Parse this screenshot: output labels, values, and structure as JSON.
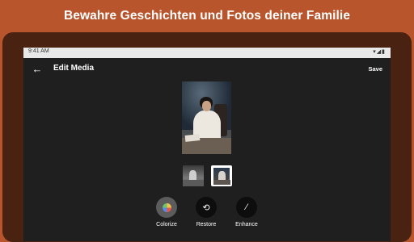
{
  "headline": "Bewahre Geschichten und Fotos deiner Familie",
  "status_bar": {
    "time": "9:41 AM",
    "icons": [
      "wifi-icon",
      "signal-icon",
      "battery-icon"
    ]
  },
  "app_bar": {
    "back_icon": "arrow-left-icon",
    "title": "Edit Media",
    "save_label": "Save"
  },
  "preview": {
    "description_icon": "photo"
  },
  "thumbnails": [
    {
      "variant": "original-bw",
      "selected": false
    },
    {
      "variant": "colorized",
      "selected": true
    }
  ],
  "tools": [
    {
      "label": "Colorize",
      "icon": "palette-icon",
      "active": true
    },
    {
      "label": "Restore",
      "icon": "restore-icon",
      "active": false
    },
    {
      "label": "Enhance",
      "icon": "magic-wand-icon",
      "active": false
    }
  ],
  "colors": {
    "banner_bg": "#b8552c",
    "device_frame": "#4a2212",
    "screen_bg": "#1f1f1f"
  }
}
